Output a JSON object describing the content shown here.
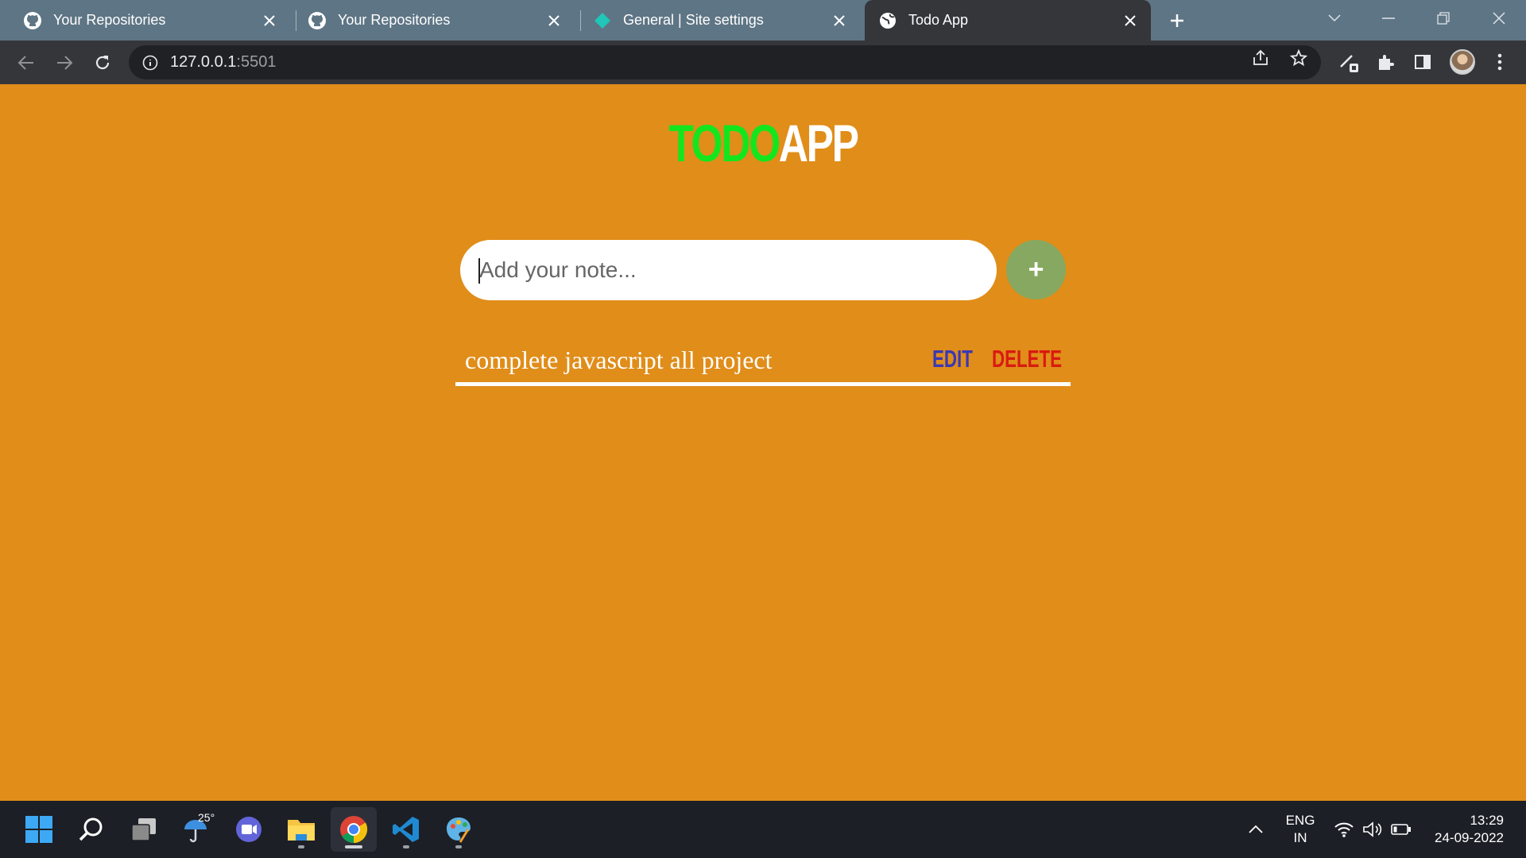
{
  "browser": {
    "tabs": [
      {
        "title": "Your Repositories",
        "icon": "github-icon",
        "active": false
      },
      {
        "title": "Your Repositories",
        "icon": "github-icon",
        "active": false
      },
      {
        "title": "General | Site settings",
        "icon": "netlify-icon",
        "active": false
      },
      {
        "title": "Todo App",
        "icon": "globe-icon",
        "active": true
      }
    ],
    "address": {
      "host": "127.0.0.1",
      "port": ":5501"
    }
  },
  "app": {
    "title_part1": "TODO",
    "title_part2": "APP",
    "input_placeholder": "Add your note...",
    "add_button_label": "+",
    "todos": [
      {
        "text": "complete javascript all project",
        "edit_label": "EDIT",
        "delete_label": "DELETE"
      }
    ],
    "colors": {
      "background": "#e08d19",
      "title_todo": "#14e61e",
      "add_button": "#87a860",
      "edit": "#3a38b5",
      "delete": "#d91a10"
    }
  },
  "taskbar": {
    "weather_temp": "25°",
    "apps": [
      "windows-start-icon",
      "search-icon",
      "task-view-icon",
      "weather-icon",
      "teams-chat-icon",
      "file-explorer-icon",
      "chrome-icon",
      "vscode-icon",
      "paint-icon"
    ],
    "language_line1": "ENG",
    "language_line2": "IN",
    "time": "13:29",
    "date": "24-09-2022"
  }
}
